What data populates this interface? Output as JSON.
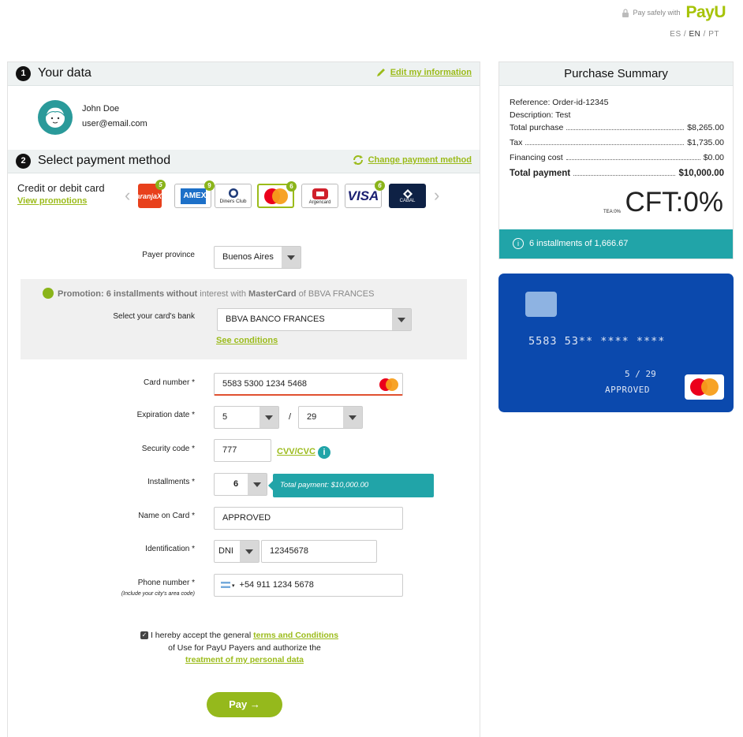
{
  "header": {
    "secure_text": "Pay safely with",
    "brand": "PayU",
    "lang_es": "ES",
    "lang_en": "EN",
    "lang_pt": "PT",
    "sep": "/"
  },
  "your_data": {
    "number": "1",
    "title": "Your data",
    "edit_link": "Edit my information",
    "name": "John Doe",
    "email": "user@email.com"
  },
  "payment_method": {
    "number": "2",
    "title": "Select payment method",
    "change_link": "Change payment method",
    "credit_label": "Credit or debit card",
    "promotions_link": "View promotions",
    "cards": [
      {
        "label": "NaranjaX",
        "badge": "5"
      },
      {
        "label": "AMEX",
        "badge": "9"
      },
      {
        "label": "Diners Club",
        "badge": ""
      },
      {
        "label": "MasterCard",
        "badge": "6"
      },
      {
        "label": "Argencard",
        "badge": ""
      },
      {
        "label": "VISA",
        "badge": "6"
      },
      {
        "label": "CABAL",
        "badge": ""
      }
    ]
  },
  "form": {
    "payer_province_label": "Payer province",
    "payer_province_value": "Buenos Aires",
    "promo_prefix": "Promotion: 6 installments without",
    "promo_mid": " interest with ",
    "promo_brand": "MasterCard",
    "promo_suffix": " of BBVA FRANCES",
    "bank_label": "Select your card's bank",
    "bank_value": "BBVA BANCO FRANCES",
    "see_conditions": "See conditions",
    "card_number_label": "Card number *",
    "card_number_value": "5583 5300 1234 5468",
    "expiration_label": "Expiration date *",
    "exp_month": "5",
    "exp_slash": "/",
    "exp_year": "29",
    "security_label": "Security code *",
    "security_value": "777",
    "cvv_link": "CVV/CVC",
    "installments_label": "Installments *",
    "installments_value": "6",
    "total_tooltip": "Total payment: $10,000.00",
    "name_label": "Name on Card *",
    "name_value": "APPROVED",
    "id_label": "Identification *",
    "id_type": "DNI",
    "id_value": "12345678",
    "phone_label": "Phone number *",
    "phone_hint": "(Include your city's area code)",
    "phone_value": "+54 911 1234 5678",
    "terms_pre": "I hereby accept the general ",
    "terms_link": "terms and Conditions",
    "terms_mid": "of Use for PayU Payers and authorize the",
    "terms_link2": "treatment of my personal data",
    "pay_button": "Pay →"
  },
  "summary": {
    "title": "Purchase Summary",
    "reference": "Reference: Order-id-12345",
    "description": "Description: Test",
    "rows": [
      {
        "label": "Total purchase",
        "value": "$8,265.00"
      },
      {
        "label": "Tax",
        "value": "$1,735.00"
      },
      {
        "label": "Financing cost",
        "value": "$0.00"
      },
      {
        "label": "Total payment",
        "value": "$10,000.00"
      }
    ],
    "tea": "TEA:0%",
    "cft": "CFT:0%",
    "installments_info": "6 installments of 1,666.67"
  },
  "card_preview": {
    "number": "5583 53** **** ****",
    "expiry": "5 / 29",
    "holder": "APPROVED"
  },
  "colors": {
    "accent_green": "#9bbb1a",
    "teal": "#21a4a8",
    "card_blue": "#0b49ad"
  }
}
